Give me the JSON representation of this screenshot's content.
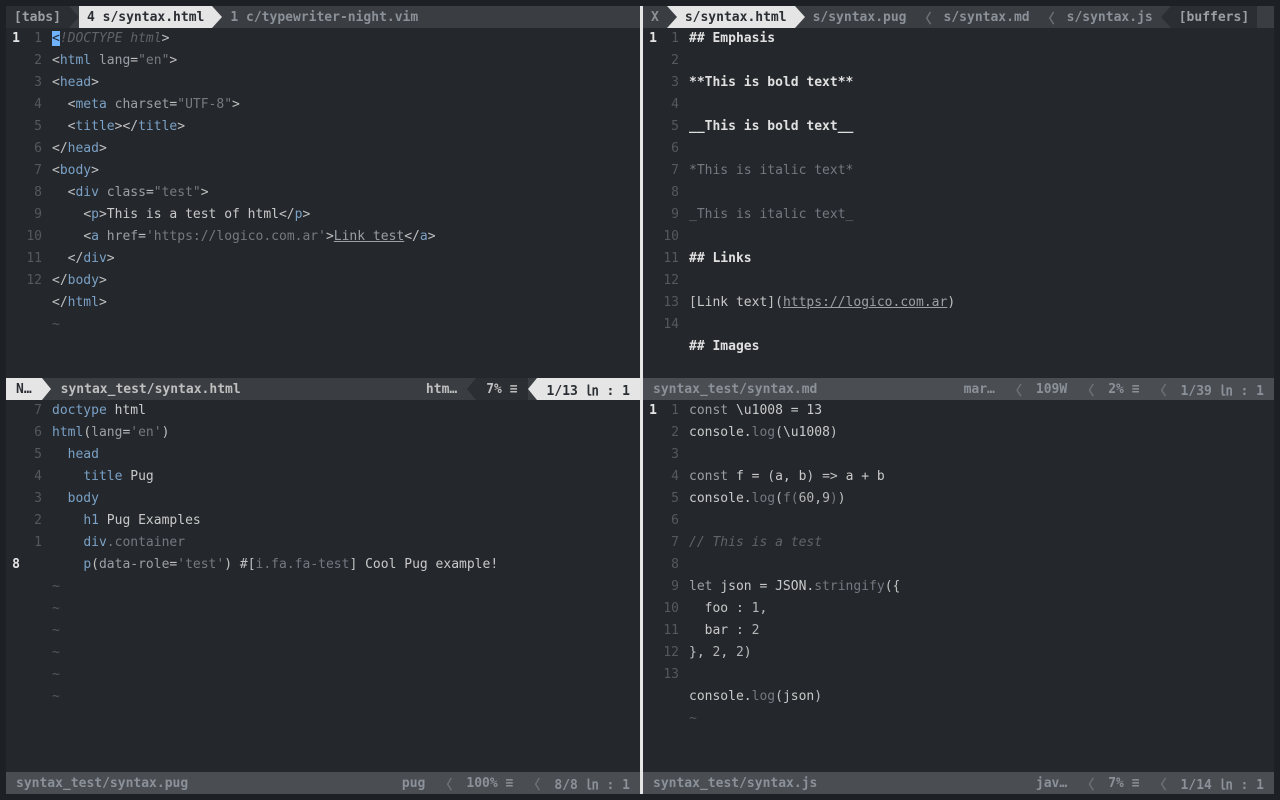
{
  "tabbars": {
    "left": {
      "label": "[tabs]",
      "tabs": [
        {
          "text": "4 s/syntax.html",
          "active": true
        },
        {
          "text": "1 c/typewriter-night.vim",
          "active": false
        }
      ]
    },
    "right": {
      "close": "X",
      "tabs": [
        {
          "text": "s/syntax.html",
          "active": true
        },
        {
          "text": "s/syntax.pug",
          "active": false
        },
        {
          "text": "s/syntax.md",
          "active": false
        },
        {
          "text": "s/syntax.js",
          "active": false
        }
      ],
      "label": "[buffers]"
    }
  },
  "panes": {
    "tl": {
      "main_gut": "1",
      "gutter": [
        "",
        "1",
        "2",
        "3",
        "4",
        "5",
        "6",
        "7",
        "8",
        "9",
        "10",
        "11",
        "12"
      ],
      "lines_html": [
        "<span class='cursor-cell'>&lt;</span><span class='c-comment'>!DOCTYPE html</span><span class='c-punc'>&gt;</span>",
        "<span class='c-punc'>&lt;</span><span class='c-tag'>html</span> <span class='c-attr'>lang</span>=<span class='c-str'>\"en\"</span><span class='c-punc'>&gt;</span>",
        "<span class='c-punc'>&lt;</span><span class='c-tag'>head</span><span class='c-punc'>&gt;</span>",
        "  <span class='c-punc'>&lt;</span><span class='c-tag'>meta</span> <span class='c-attr'>charset</span>=<span class='c-str'>\"UTF-8\"</span><span class='c-punc'>&gt;</span>",
        "  <span class='c-punc'>&lt;</span><span class='c-tag'>title</span><span class='c-punc'>&gt;&lt;/</span><span class='c-tag'>title</span><span class='c-punc'>&gt;</span>",
        "<span class='c-punc'>&lt;/</span><span class='c-tag'>head</span><span class='c-punc'>&gt;</span>",
        "<span class='c-punc'>&lt;</span><span class='c-tag'>body</span><span class='c-punc'>&gt;</span>",
        "  <span class='c-punc'>&lt;</span><span class='c-tag'>div</span> <span class='c-attr'>class</span>=<span class='c-str'>\"test\"</span><span class='c-punc'>&gt;</span>",
        "    <span class='c-punc'>&lt;</span><span class='c-tag'>p</span><span class='c-punc'>&gt;</span><span class='c-text'>This is a test of html</span><span class='c-punc'>&lt;/</span><span class='c-tag'>p</span><span class='c-punc'>&gt;</span>",
        "    <span class='c-punc'>&lt;</span><span class='c-tag'>a</span> <span class='c-attr'>href</span>=<span class='c-str'>'https://logico.com.ar'</span><span class='c-punc'>&gt;</span><span class='c-link'>Link test</span><span class='c-punc'>&lt;/</span><span class='c-tag'>a</span><span class='c-punc'>&gt;</span>",
        "  <span class='c-punc'>&lt;/</span><span class='c-tag'>div</span><span class='c-punc'>&gt;</span>",
        "<span class='c-punc'>&lt;/</span><span class='c-tag'>body</span><span class='c-punc'>&gt;</span>",
        "<span class='c-punc'>&lt;/</span><span class='c-tag'>html</span><span class='c-punc'>&gt;</span>"
      ],
      "tilde_rows": 1,
      "status": {
        "mode": "N…",
        "path": "syntax_test/syntax.html",
        "ft": "htm…",
        "pct": "7% ≡",
        "pos": "1/13 ㏑ :  1",
        "active": true
      }
    },
    "tr": {
      "main_gut": "1",
      "gutter": [
        "",
        "1",
        "2",
        "3",
        "4",
        "5",
        "6",
        "7",
        "8",
        "9",
        "10",
        "11",
        "12",
        "13",
        "14"
      ],
      "lines_html": [
        "<span class='c-bold'>## Emphasis</span>",
        "",
        "<span class='c-bold'>**This is bold text**</span>",
        "",
        "<span class='c-bold'>__This is bold text__</span>",
        "",
        "<span class='c-dim'>*This is italic text*</span>",
        "",
        "<span class='c-dim'>_This is italic text_</span>",
        "",
        "<span class='c-bold'>## Links</span>",
        "",
        "<span class='c-punc'>[</span><span class='c-text'>Link text</span><span class='c-punc'>](</span><span class='c-link'>https://logico.com.ar</span><span class='c-punc'>)</span>",
        "",
        "<span class='c-bold'>## Images</span>"
      ],
      "tilde_rows": 0,
      "status": {
        "path": "syntax_test/syntax.md",
        "ft": "mar…",
        "extra": "109W",
        "pct": "2% ≡",
        "pos": "1/39 ㏑ :  1",
        "active": false
      }
    },
    "bl": {
      "main_gut": "8",
      "gutter": [
        "7",
        "6",
        "5",
        "4",
        "3",
        "2",
        "1",
        ""
      ],
      "cur_idx": 7,
      "lines_html": [
        "<span class='c-tag'>doctype</span> <span class='c-text'>html</span>",
        "<span class='c-tag'>html</span><span class='c-punc'>(</span><span class='c-attr'>lang</span>=<span class='c-str'>'en'</span><span class='c-punc'>)</span>",
        "  <span class='c-tag'>head</span>",
        "    <span class='c-tag'>title</span> <span class='c-text'>Pug</span>",
        "  <span class='c-tag'>body</span>",
        "    <span class='c-tag'>h1</span> <span class='c-text'>Pug Examples</span>",
        "    <span class='c-tag'>div</span><span class='c-dim'>.container</span>",
        "    <span class='c-tag'>p</span><span class='c-punc'>(</span><span class='c-attr'>data-role</span>=<span class='c-str'>'test'</span><span class='c-punc'>)</span> <span class='c-punc'>#[</span><span class='c-dim'>i.fa.fa-test</span><span class='c-punc'>]</span> <span class='c-text'>Cool Pug example!</span>"
      ],
      "tilde_rows": 6,
      "status": {
        "path": "syntax_test/syntax.pug",
        "ft": "pug",
        "pct": "100% ≡",
        "pos": "8/8 ㏑ :  1",
        "active": false
      }
    },
    "br": {
      "main_gut": "1",
      "gutter": [
        "",
        "1",
        "2",
        "3",
        "4",
        "5",
        "6",
        "7",
        "8",
        "9",
        "10",
        "11",
        "12",
        "13"
      ],
      "lines_html": [
        "<span class='c-kw'>const</span> <span class='c-text'>\\u1008 = 13</span>",
        "<span class='c-text'>console.</span><span class='c-dim'>log</span><span class='c-punc'>(</span><span class='c-text'>\\u1008</span><span class='c-punc'>)</span>",
        "",
        "<span class='c-kw'>const</span> <span class='c-text'>f = </span><span class='c-punc'>(</span><span class='c-text'>a, b</span><span class='c-punc'>)</span> <span class='c-punc'>=&gt;</span> <span class='c-text'>a + b</span>",
        "<span class='c-text'>console.</span><span class='c-dim'>log</span><span class='c-punc'>(</span><span class='c-dim'>f(</span><span class='c-num'>60</span><span class='c-punc'>,</span><span class='c-num'>9</span><span class='c-dim'>)</span><span class='c-punc'>)</span>",
        "",
        "<span class='c-comment'>// This is a test</span>",
        "",
        "<span class='c-kw'>let</span> <span class='c-text'>json = JSON.</span><span class='c-dim'>stringify</span><span class='c-punc'>({</span>",
        "  <span class='c-text'>foo</span> <span class='c-punc'>:</span> <span class='c-num'>1</span><span class='c-punc'>,</span>",
        "  <span class='c-text'>bar</span> <span class='c-punc'>:</span> <span class='c-num'>2</span>",
        "<span class='c-punc'>},</span> <span class='c-num'>2</span><span class='c-punc'>,</span> <span class='c-num'>2</span><span class='c-punc'>)</span>",
        "",
        "<span class='c-text'>console.</span><span class='c-dim'>log</span><span class='c-punc'>(</span><span class='c-text'>json</span><span class='c-punc'>)</span>"
      ],
      "tilde_rows": 1,
      "status": {
        "path": "syntax_test/syntax.js",
        "ft": "jav…",
        "pct": "7% ≡",
        "pos": "1/14 ㏑ :  1",
        "active": false
      }
    }
  }
}
